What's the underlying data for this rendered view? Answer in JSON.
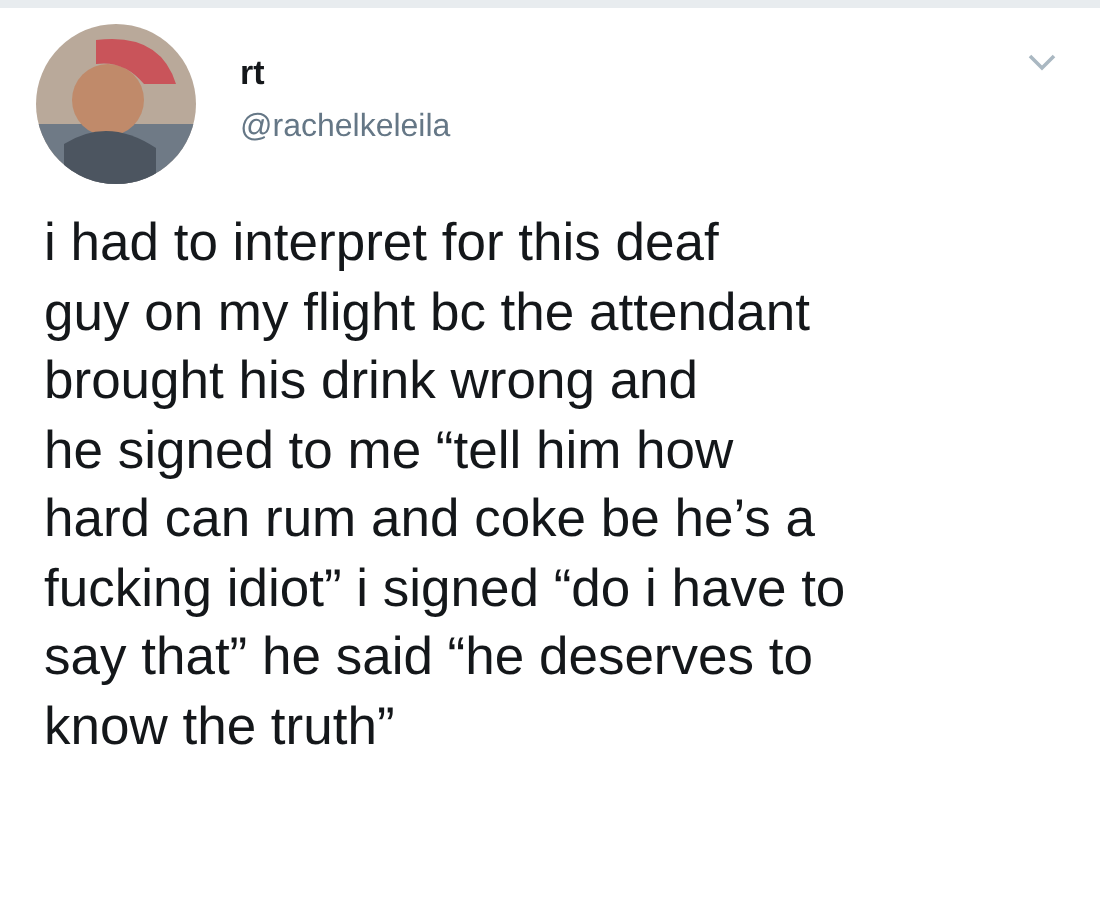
{
  "tweet": {
    "display_name": "rt",
    "handle": "@rachelkeleila",
    "text": "i had to interpret for this deaf\nguy on my flight bc the attendant\nbrought his drink wrong and\nhe signed to me “tell him how\nhard can rum and coke be he’s a\nfucking idiot” i signed “do i have to\nsay that” he said “he deserves to\nknow the truth”"
  }
}
